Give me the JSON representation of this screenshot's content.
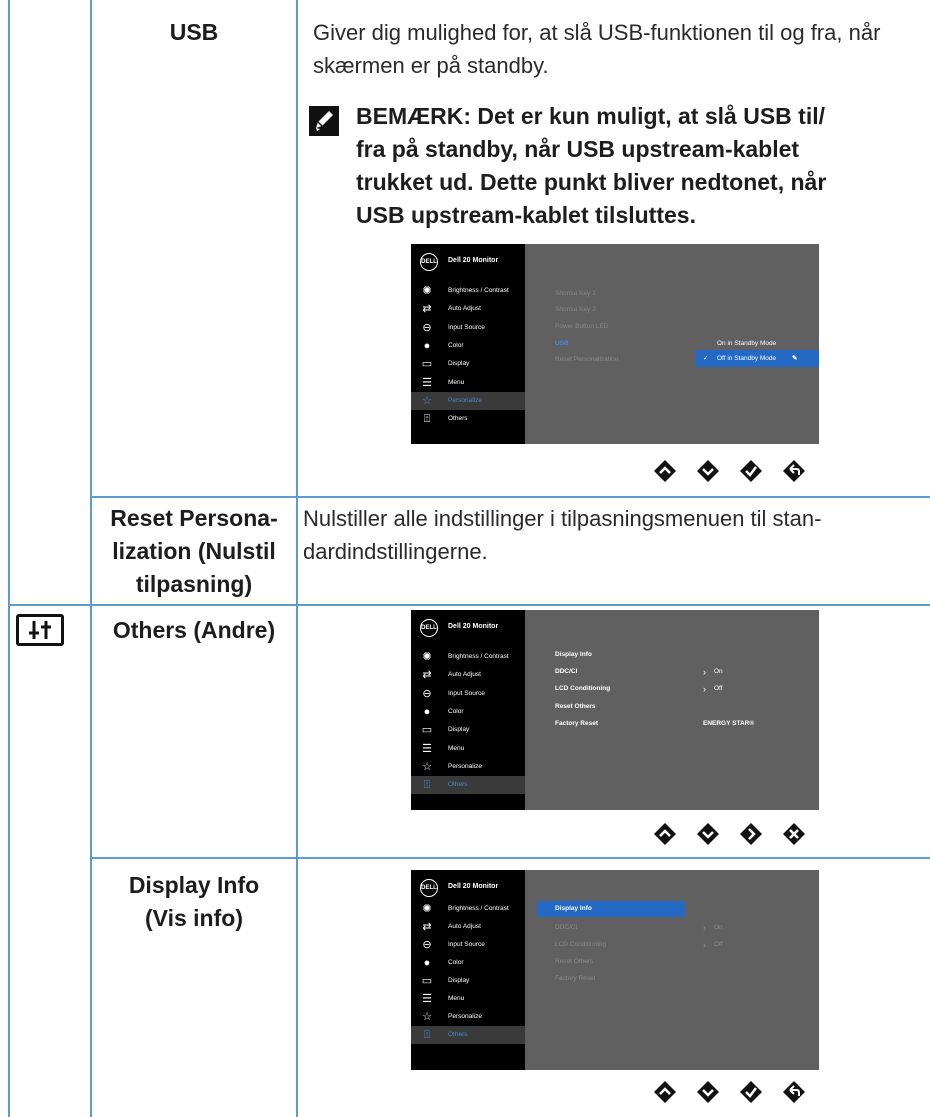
{
  "rows": {
    "usb": {
      "label": "USB",
      "description": "Giver dig mulighed for, at slå USB-funktionen til og fra, når skærmen er på standby.",
      "note_lines": [
        "BEMÆRK: Det er kun muligt, at slå USB til/",
        "fra på standby, når USB upstream-kablet",
        "trukket ud. Dette punkt bliver nedtonet, når",
        "USB upstream-kablet tilsluttes."
      ]
    },
    "reset_personalization": {
      "label_lines": [
        "Reset Persona-",
        "lization (Nulstil",
        "tilpasning)"
      ],
      "description_lines": [
        "Nulstiller alle indstillinger i tilpasningsmenuen til stan-",
        "dardindstillingerne."
      ]
    },
    "others": {
      "label": "Others (Andre)"
    },
    "display_info": {
      "label_lines": [
        "Display Info",
        "(Vis info)"
      ]
    }
  },
  "osd": {
    "logo": "DELL",
    "title": "Dell 20 Monitor",
    "menu_items": [
      "Brightness / Contrast",
      "Auto Adjust",
      "Input Source",
      "Color",
      "Display",
      "Menu",
      "Personalize",
      "Others"
    ],
    "menu_icons": [
      "brightness-icon",
      "auto-adjust-icon",
      "input-source-icon",
      "color-icon",
      "display-icon",
      "menu-icon",
      "personalize-icon",
      "others-icon"
    ],
    "personalize": {
      "items": [
        "Shorcut Key 1",
        "Shorcut Key 2",
        "Power Button LED",
        "USB",
        "Reset Personalization"
      ],
      "usb_options": [
        "On in Standby Mode",
        "Off in Standby Mode"
      ]
    },
    "others_menu": {
      "items": [
        "Display Info",
        "DDC/CI",
        "LCD Conditioning",
        "Reset Others",
        "Factory Reset"
      ],
      "ddc_value": "On",
      "lcd_value": "Off",
      "factory_value": "ENERGY STAR®"
    }
  },
  "colors": {
    "rule": "#5d9bd1",
    "osd_highlight": "#2469c4",
    "osd_selected_text": "#4a88d9"
  }
}
